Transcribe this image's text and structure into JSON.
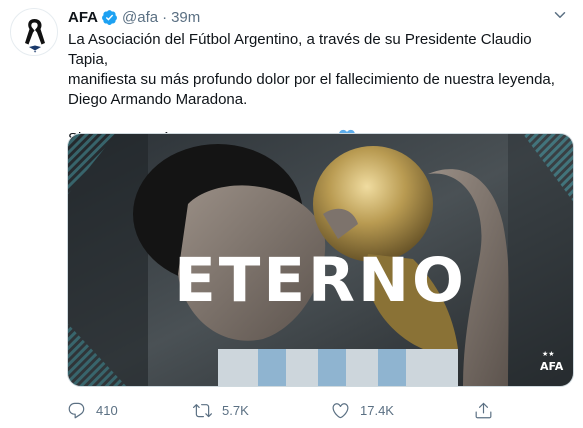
{
  "tweet": {
    "author_name": "AFA",
    "handle": "@afa",
    "separator": "·",
    "time": "39m",
    "text_lines": [
      "La Asociación del Fútbol Argentino, a través de su Presidente Claudio Tapia,",
      "manifiesta su más profundo dolor por el fallecimiento de nuestra leyenda,",
      "Diego Armando Maradona."
    ],
    "text_second_paragraph": "Siempre estarás en nuestros corazones",
    "media": {
      "headline": "ETERNO",
      "logo_text": "AFA"
    },
    "stats": {
      "replies": "410",
      "retweets": "5.7K",
      "likes": "17.4K"
    }
  },
  "icons": {
    "avatar": "black-mourning-ribbon-icon",
    "verified": "verified-badge-icon",
    "caret": "chevron-down-icon",
    "emoji": "light-blue-heart-icon",
    "reply": "reply-icon",
    "retweet": "retweet-icon",
    "like": "heart-icon",
    "share": "share-icon"
  },
  "colors": {
    "verified_blue": "#1da1f2",
    "muted_text": "#5b7083",
    "emoji_light_blue": "#5dadec",
    "media_teal": "#5fd3e0"
  }
}
